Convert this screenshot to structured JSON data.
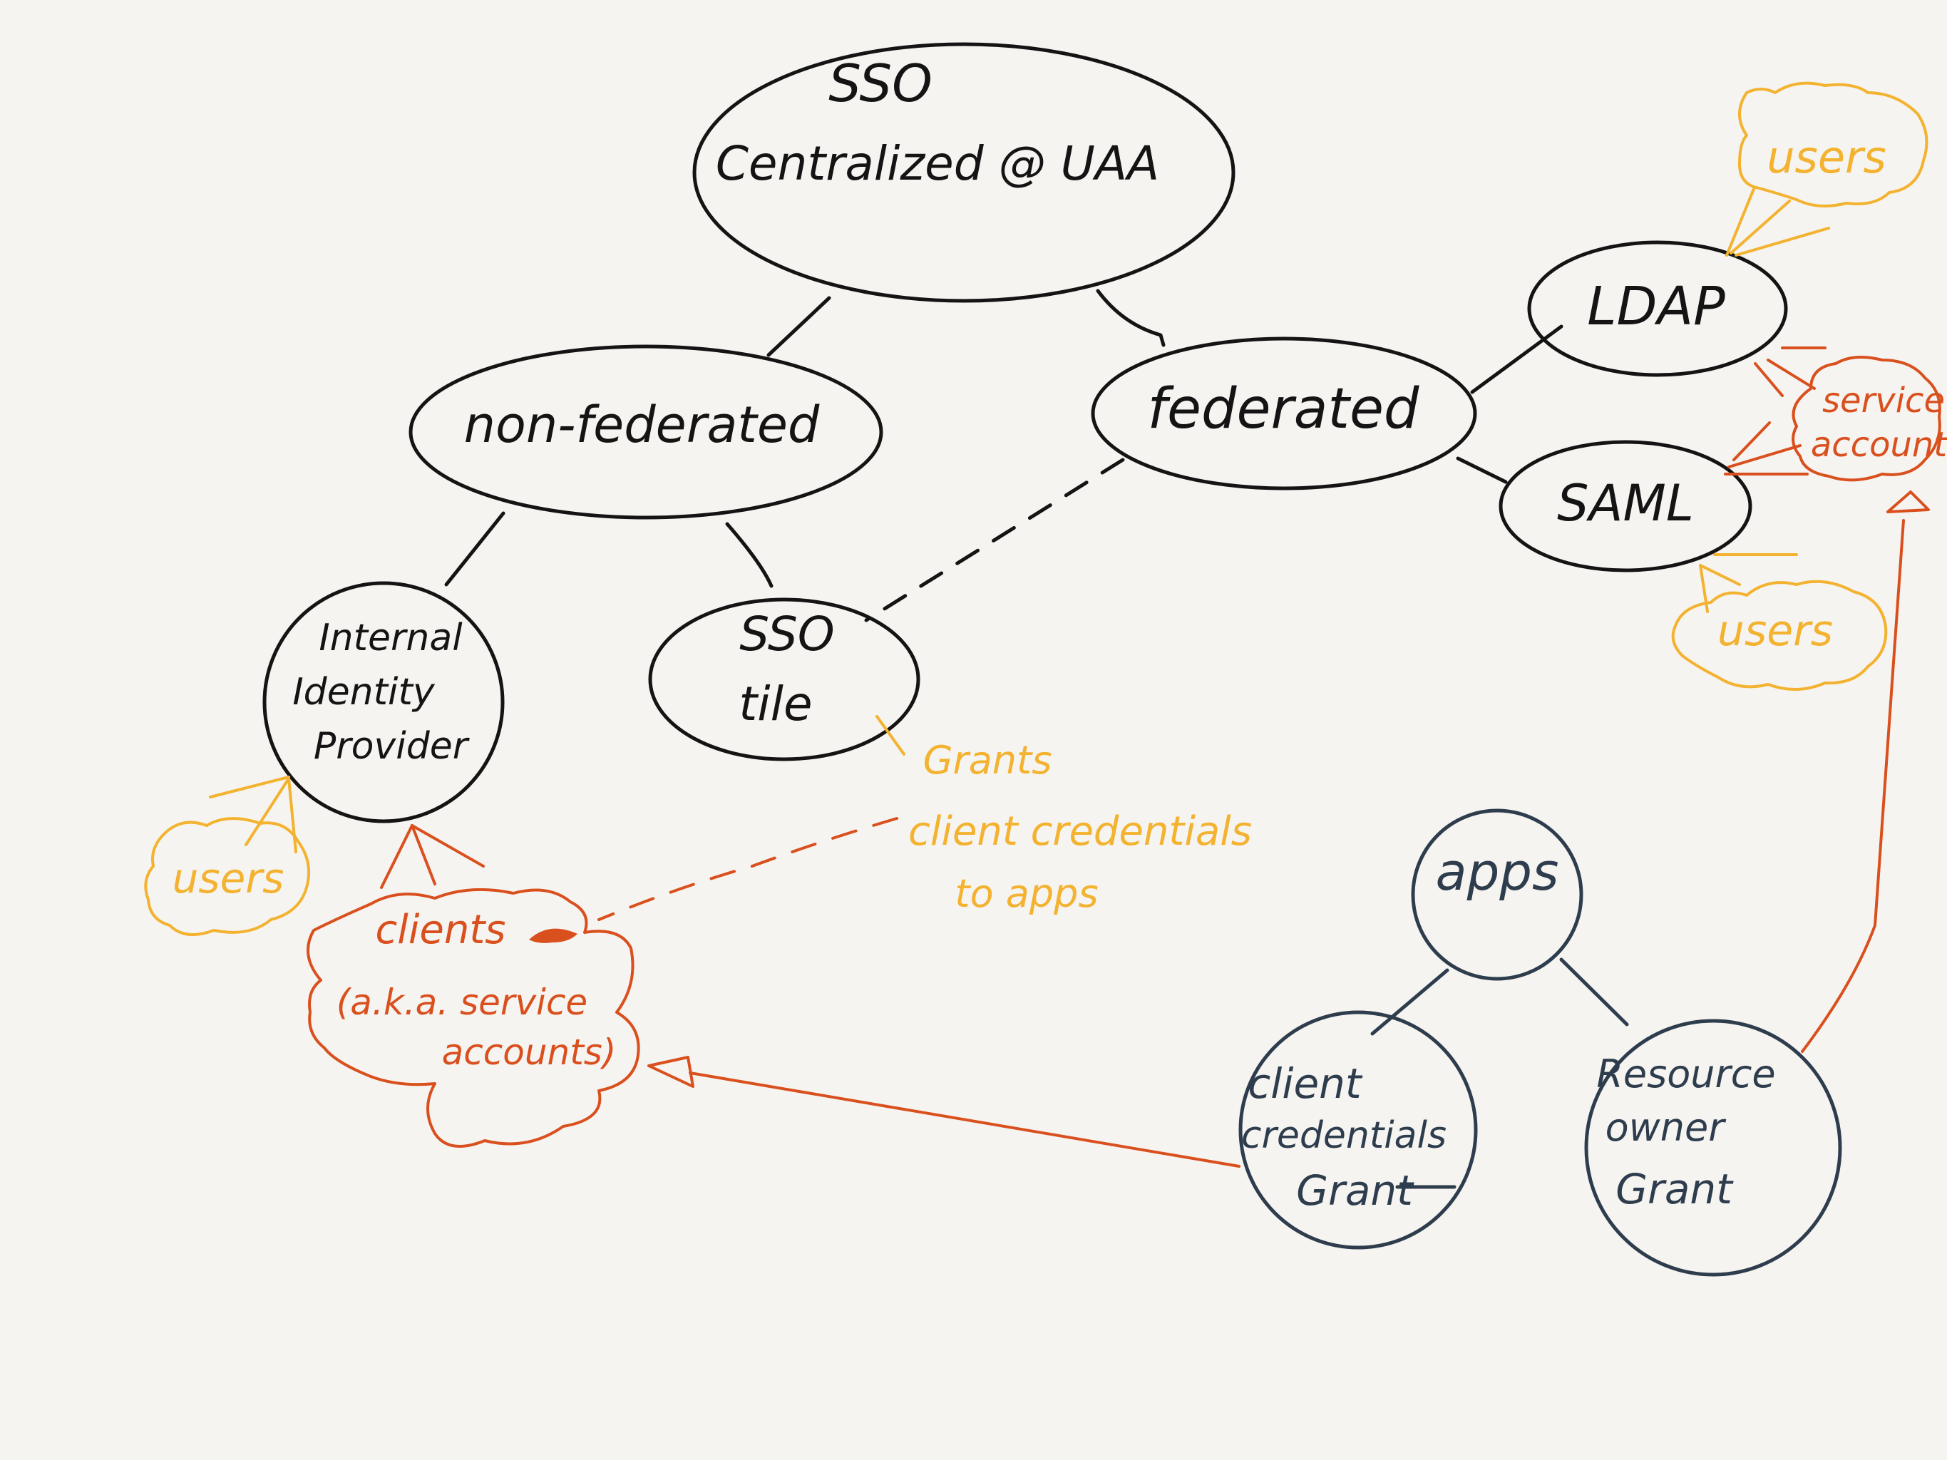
{
  "colors": {
    "background": "#f6f4f0",
    "ink_black": "#141414",
    "ink_navy": "#2e3d4d",
    "ink_orange": "#d9501e",
    "ink_yellow": "#f3b22f"
  },
  "nodes": {
    "sso_root": {
      "line1": "SSO",
      "line2": "Centralized @ UAA"
    },
    "non_federated": {
      "label": "non-federated"
    },
    "federated": {
      "label": "federated"
    },
    "ldap": {
      "label": "LDAP"
    },
    "saml": {
      "label": "SAML"
    },
    "internal_idp": {
      "line1": "Internal",
      "line2": "Identity",
      "line3": "Provider"
    },
    "sso_tile": {
      "line1": "SSO",
      "line2": "tile"
    },
    "apps": {
      "label": "apps"
    },
    "client_credentials_grant": {
      "line1": "client",
      "line2": "credentials",
      "line3": "Grant"
    },
    "resource_owner_grant": {
      "line1": "Resource",
      "line2": "owner",
      "line3": "Grant"
    }
  },
  "clouds": {
    "users_ldap": {
      "label": "users"
    },
    "users_saml": {
      "label": "users"
    },
    "users_idp": {
      "label": "users"
    },
    "service_accounts": {
      "line1": "service",
      "line2": "accounts"
    },
    "clients": {
      "line1": "clients",
      "line2": "(a.k.a. service",
      "line3": "accounts)"
    }
  },
  "annotations": {
    "grants_note": {
      "line1": "Grants",
      "line2": "client credentials",
      "line3": "to apps"
    }
  }
}
